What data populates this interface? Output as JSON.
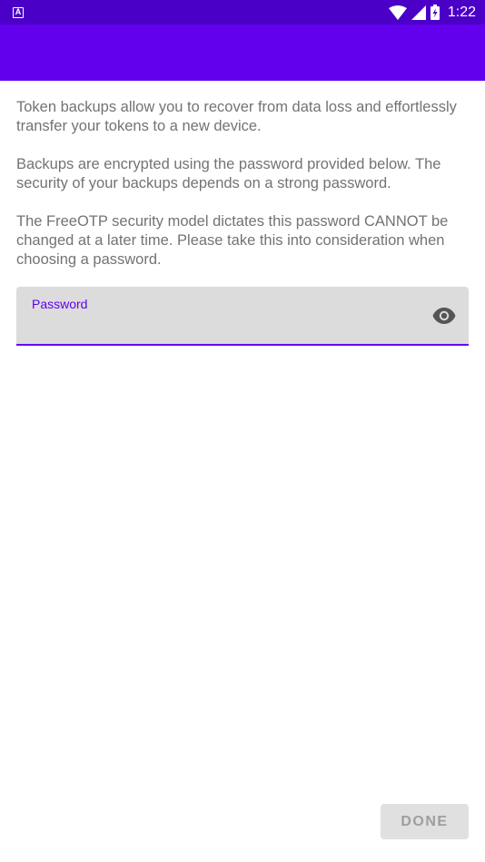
{
  "status_bar": {
    "notification_icon_letter": "A",
    "time": "1:22"
  },
  "intro": {
    "paragraphs": [
      "Token backups allow you to recover from data loss and effortlessly transfer your tokens to a new device.",
      "Backups are encrypted using the password provided below. The security of your backups depends on a strong password.",
      "The FreeOTP security model dictates this password CANNOT be changed at a later time. Please take this into consideration when choosing a password."
    ]
  },
  "password_field": {
    "label": "Password",
    "value": ""
  },
  "actions": {
    "done_label": "DONE"
  },
  "colors": {
    "status_bar": "#4a00c7",
    "app_bar": "#6200ee",
    "accent": "#6200ee",
    "field_background": "#dcdcdc",
    "body_text": "#737373",
    "done_disabled_bg": "#e0e0e0",
    "done_disabled_text": "#9e9e9e"
  },
  "icons": {
    "notification": "a-letter-icon",
    "wifi": "wifi-icon",
    "signal": "cell-signal-icon",
    "battery": "battery-charging-icon",
    "visibility": "eye-icon"
  }
}
